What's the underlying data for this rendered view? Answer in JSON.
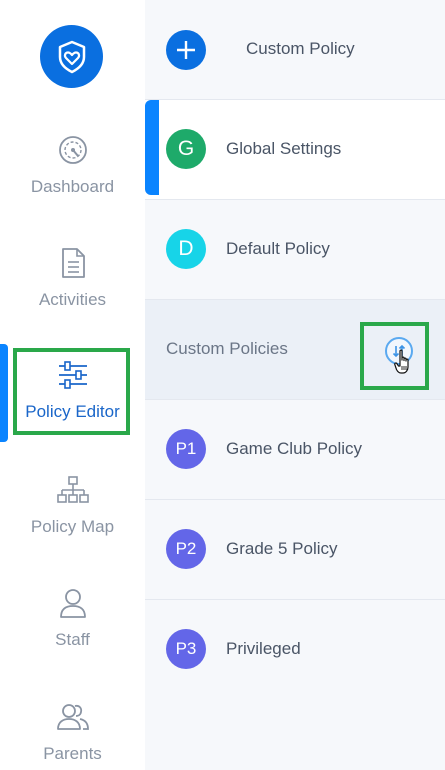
{
  "colors": {
    "primary": "#0a6fe0",
    "active_accent": "#0a84ff",
    "highlight": "#2aa84a",
    "global_badge": "#1eaa6a",
    "default_badge": "#17d4e8",
    "custom_badge": "#6366e8"
  },
  "sidebar": {
    "logo_icon": "shield-heart-icon",
    "items": [
      {
        "label": "Dashboard",
        "icon": "gauge-icon"
      },
      {
        "label": "Activities",
        "icon": "document-icon"
      },
      {
        "label": "Policy Editor",
        "icon": "sliders-icon",
        "active": true
      },
      {
        "label": "Policy Map",
        "icon": "sitemap-icon"
      },
      {
        "label": "Staff",
        "icon": "user-icon"
      },
      {
        "label": "Parents",
        "icon": "users-icon"
      }
    ]
  },
  "panel": {
    "add_row": {
      "label": "Custom Policy",
      "icon": "plus-icon"
    },
    "global": {
      "badge": "G",
      "label": "Global Settings"
    },
    "default": {
      "badge": "D",
      "label": "Default Policy"
    },
    "section": {
      "label": "Custom Policies",
      "sort_icon": "sort-arrows-icon"
    },
    "policies": [
      {
        "badge": "P1",
        "label": "Game Club Policy"
      },
      {
        "badge": "P2",
        "label": "Grade 5 Policy"
      },
      {
        "badge": "P3",
        "label": "Privileged"
      }
    ]
  }
}
